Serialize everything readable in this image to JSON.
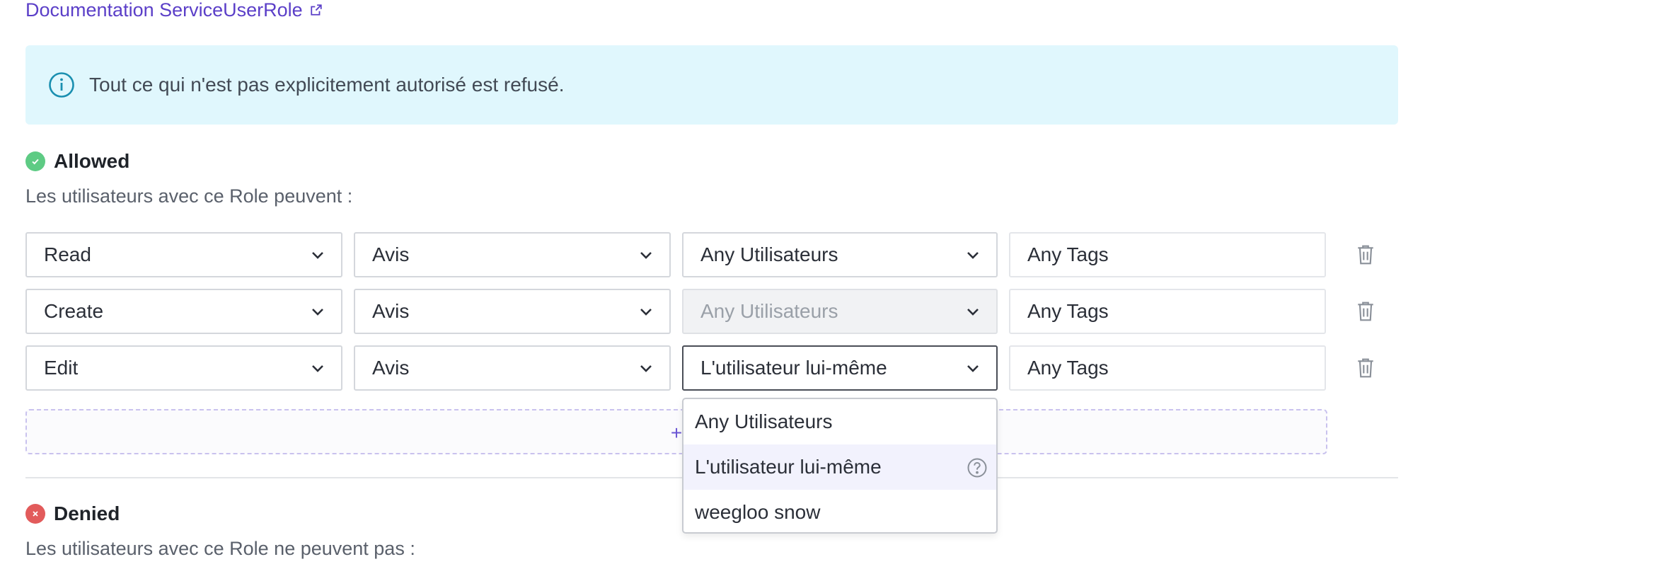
{
  "doc_link": {
    "label": "Documentation ServiceUserRole",
    "icon": "external-link-icon"
  },
  "info_banner": {
    "text": "Tout ce qui n'est pas explicitement autorisé est refusé.",
    "icon": "info-icon"
  },
  "allowed": {
    "title": "Allowed",
    "subtitle": "Les utilisateurs avec ce Role peuvent :",
    "rows": [
      {
        "action": "Read",
        "resource": "Avis",
        "scope": "Any Utilisateurs",
        "tags": "Any Tags"
      },
      {
        "action": "Create",
        "resource": "Avis",
        "scope": "Any Utilisateurs",
        "tags": "Any Tags"
      },
      {
        "action": "Edit",
        "resource": "Avis",
        "scope": "L'utilisateur lui-même",
        "tags": "Any Tags"
      }
    ],
    "add_label": "+"
  },
  "scope_dropdown": {
    "options": [
      "Any Utilisateurs",
      "L'utilisateur lui-même",
      "weegloo snow"
    ],
    "highlighted": "L'utilisateur lui-même"
  },
  "denied": {
    "title": "Denied",
    "subtitle": "Les utilisateurs avec ce Role ne peuvent pas :"
  },
  "colors": {
    "accent": "#5b3fc8",
    "allowed": "#5ecb84",
    "denied": "#e25b5b",
    "banner_bg": "#e0f7fd",
    "info": "#1a8fb0"
  }
}
